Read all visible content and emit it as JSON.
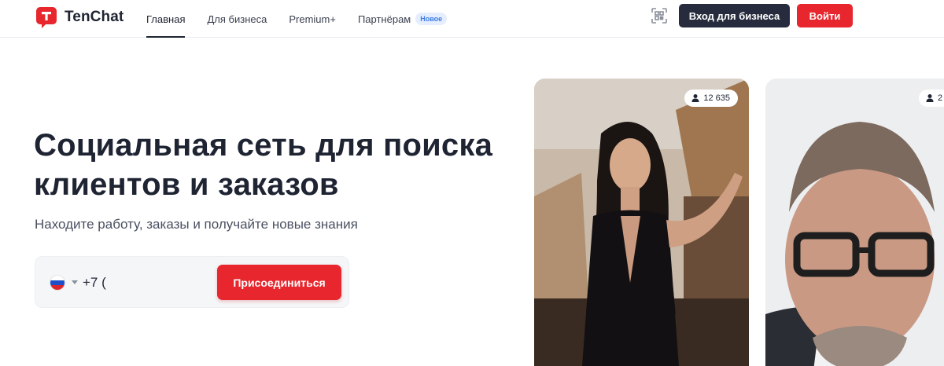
{
  "brand": {
    "name": "TenChat",
    "color": "#e7262d"
  },
  "nav": {
    "items": [
      {
        "label": "Главная",
        "active": true
      },
      {
        "label": "Для бизнеса",
        "active": false
      },
      {
        "label": "Premium+",
        "active": false
      },
      {
        "label": "Партнёрам",
        "active": false,
        "badge": "Новое"
      }
    ]
  },
  "header": {
    "qr_icon": "qr-code-icon",
    "business_login": "Вход для бизнеса",
    "login": "Войти"
  },
  "hero": {
    "title": "Социальная сеть для поиска клиентов и заказов",
    "subtitle": "Находите работу, заказы и получайте новые знания"
  },
  "join": {
    "country_flag": "russia-flag-icon",
    "phone_value": "+7 (",
    "button": "Присоединиться"
  },
  "cards": [
    {
      "followers": "12 635"
    },
    {
      "followers": "2"
    }
  ]
}
